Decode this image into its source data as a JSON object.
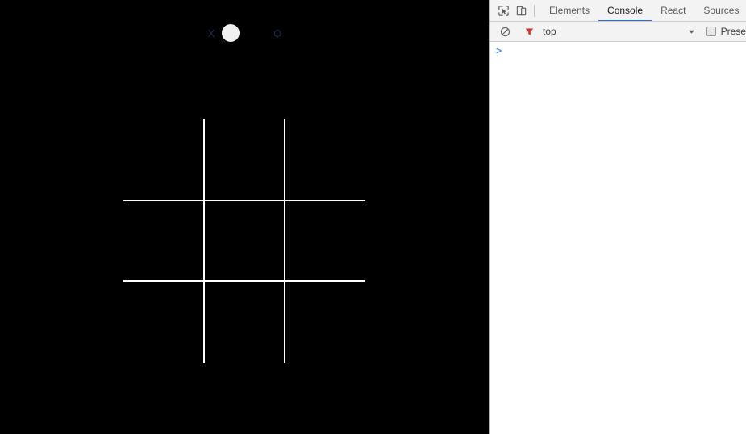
{
  "page": {
    "background_color": "#000000",
    "toggle": {
      "left_label": "X",
      "right_label": "O",
      "label_color": "#1b2a4a",
      "knob_color": "#f0f0f0",
      "knob_position": "left",
      "selected": "X"
    },
    "board": {
      "line_color": "#ffffff",
      "cells": [
        "",
        "",
        "",
        "",
        "",
        "",
        "",
        "",
        ""
      ]
    }
  },
  "devtools": {
    "icons": {
      "inspect": "inspect-element-icon",
      "device": "device-toolbar-icon"
    },
    "tabs": [
      {
        "label": "Elements",
        "active": false
      },
      {
        "label": "Console",
        "active": true
      },
      {
        "label": "React",
        "active": false
      },
      {
        "label": "Sources",
        "active": false
      }
    ],
    "active_tab_underline_color": "#1a73e8",
    "toolbar": {
      "clear_icon": "clear-console-icon",
      "filter_icon": "filter-funnel-icon",
      "filter_icon_color": "#d93025",
      "context": "top",
      "context_caret": "chevron-down-icon",
      "preserve_log_label": "Prese",
      "preserve_log_checked": false
    },
    "console": {
      "prompt_chevron": ">",
      "prompt_value": "",
      "prompt_placeholder": "",
      "messages": []
    }
  }
}
